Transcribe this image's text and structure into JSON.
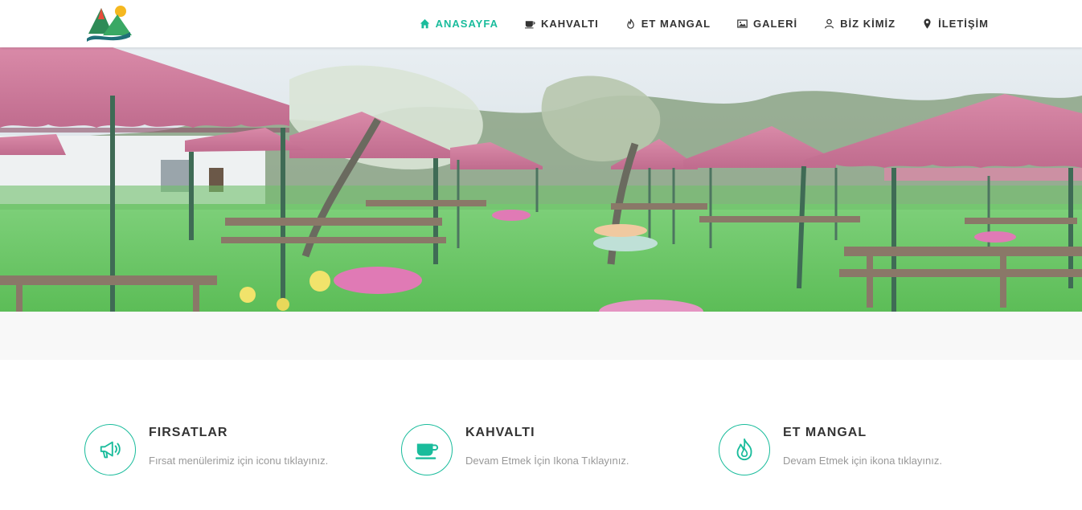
{
  "brand": {
    "logo_icon": "mountain-sun-logo",
    "accent_color": "#1abc9c"
  },
  "nav": {
    "items": [
      {
        "label": "ANASAYFA",
        "icon": "home-icon",
        "active": true
      },
      {
        "label": "KAHVALTI",
        "icon": "coffee-cup-icon",
        "active": false
      },
      {
        "label": "ET MANGAL",
        "icon": "fire-icon",
        "active": false
      },
      {
        "label": "GALERİ",
        "icon": "image-icon",
        "active": false
      },
      {
        "label": "BİZ KİMİZ",
        "icon": "user-icon",
        "active": false
      },
      {
        "label": "İLETİŞİM",
        "icon": "map-marker-icon",
        "active": false
      }
    ]
  },
  "hero": {
    "image": "garden-umbrellas-photo"
  },
  "features": [
    {
      "title": "FIRSATLAR",
      "description": "Fırsat menülerimiz için iconu tıklayınız.",
      "icon": "megaphone-icon"
    },
    {
      "title": "KAHVALTI",
      "description": "Devam Etmek İçin Ikona Tıklayınız.",
      "icon": "coffee-cup-icon"
    },
    {
      "title": "ET MANGAL",
      "description": "Devam Etmek için ikona tıklayınız.",
      "icon": "fire-icon"
    }
  ]
}
